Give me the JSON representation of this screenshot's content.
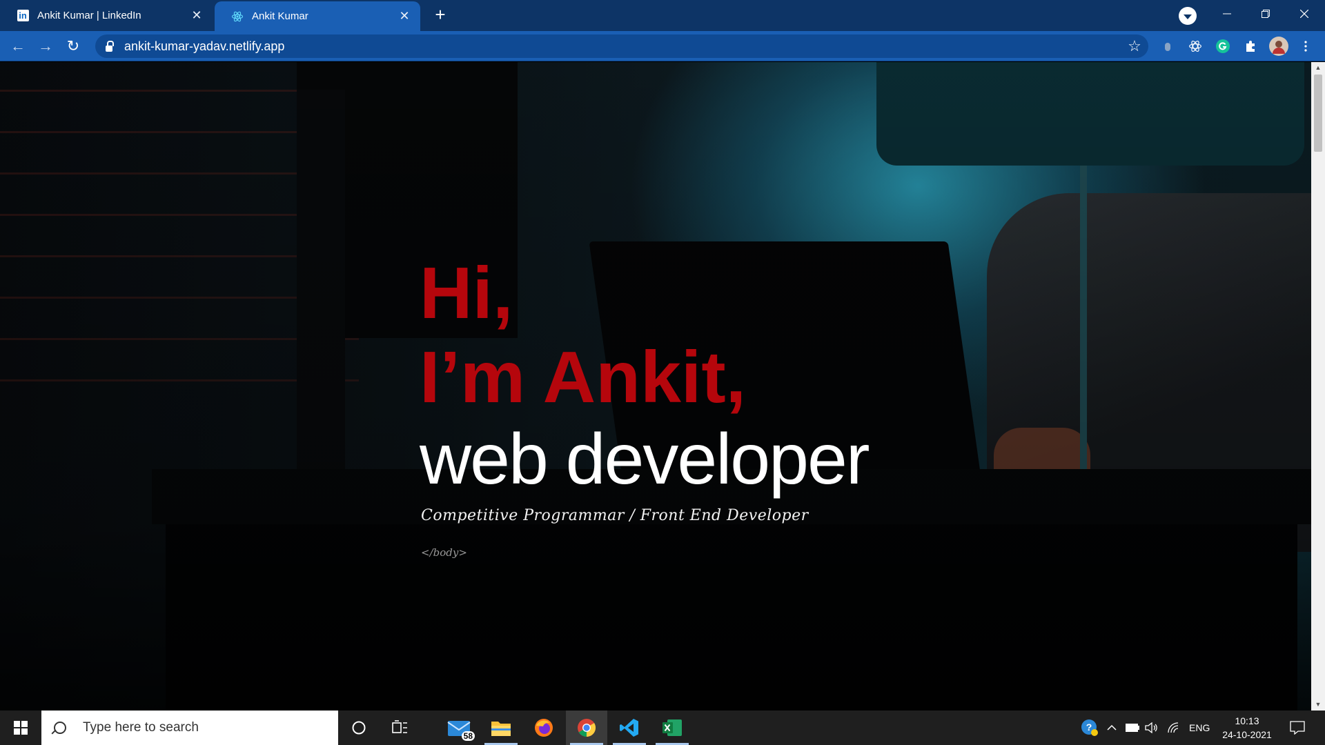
{
  "browser": {
    "tabs": [
      {
        "title": "Ankit Kumar | LinkedIn",
        "icon": "linkedin-icon",
        "active": false,
        "icon_text": "in"
      },
      {
        "title": "Ankit Kumar",
        "icon": "react-icon",
        "active": true
      }
    ],
    "url": "ankit-kumar-yadav.netlify.app",
    "controls": {
      "new_tab": "+",
      "close": "✕",
      "back": "←",
      "forward": "→",
      "reload": "↻",
      "bookmark": "☆"
    }
  },
  "page": {
    "greeting": "Hi,",
    "name_line": "I’m Ankit,",
    "role": "web developer",
    "subtitle": "Competitive Programmar / Front End Developer",
    "tag": "</body>",
    "colors": {
      "accent": "#b5060c",
      "text": "#ffffff"
    }
  },
  "taskbar": {
    "search_placeholder": "Type here to search",
    "mail_badge": "58",
    "language": "ENG",
    "time": "10:13",
    "date": "24-10-2021",
    "apps": [
      "cortana-icon",
      "task-view-icon",
      "mail-icon",
      "file-explorer-icon",
      "firefox-icon",
      "chrome-icon",
      "vscode-icon",
      "excel-icon"
    ]
  }
}
